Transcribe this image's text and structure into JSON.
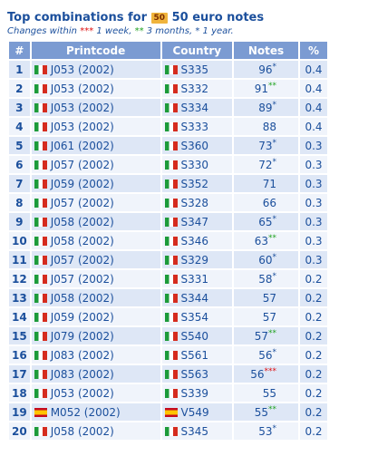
{
  "header": {
    "title_prefix": "Top combinations for",
    "badge": "50",
    "title_suffix": "50 euro notes"
  },
  "legend": {
    "prefix": "Changes within",
    "week_marker": "***",
    "week_text": "1 week,",
    "months_marker": "**",
    "months_text": "3 months,",
    "year_marker": "*",
    "year_text": "1 year."
  },
  "table": {
    "columns": [
      "#",
      "Printcode",
      "Country",
      "Notes",
      "%"
    ],
    "rows": [
      {
        "rank": "1",
        "flag": "italy-flag-icon",
        "printcode": "J053 (2002)",
        "cflag": "italy-flag-icon",
        "country": "S335",
        "notes": "96",
        "mark": "*",
        "pct": "0.4"
      },
      {
        "rank": "2",
        "flag": "italy-flag-icon",
        "printcode": "J053 (2002)",
        "cflag": "italy-flag-icon",
        "country": "S332",
        "notes": "91",
        "mark": "**",
        "pct": "0.4"
      },
      {
        "rank": "3",
        "flag": "italy-flag-icon",
        "printcode": "J053 (2002)",
        "cflag": "italy-flag-icon",
        "country": "S334",
        "notes": "89",
        "mark": "*",
        "pct": "0.4"
      },
      {
        "rank": "4",
        "flag": "italy-flag-icon",
        "printcode": "J053 (2002)",
        "cflag": "italy-flag-icon",
        "country": "S333",
        "notes": "88",
        "mark": "",
        "pct": "0.4"
      },
      {
        "rank": "5",
        "flag": "italy-flag-icon",
        "printcode": "J061 (2002)",
        "cflag": "italy-flag-icon",
        "country": "S360",
        "notes": "73",
        "mark": "*",
        "pct": "0.3"
      },
      {
        "rank": "6",
        "flag": "italy-flag-icon",
        "printcode": "J057 (2002)",
        "cflag": "italy-flag-icon",
        "country": "S330",
        "notes": "72",
        "mark": "*",
        "pct": "0.3"
      },
      {
        "rank": "7",
        "flag": "italy-flag-icon",
        "printcode": "J059 (2002)",
        "cflag": "italy-flag-icon",
        "country": "S352",
        "notes": "71",
        "mark": "",
        "pct": "0.3"
      },
      {
        "rank": "8",
        "flag": "italy-flag-icon",
        "printcode": "J057 (2002)",
        "cflag": "italy-flag-icon",
        "country": "S328",
        "notes": "66",
        "mark": "",
        "pct": "0.3"
      },
      {
        "rank": "9",
        "flag": "italy-flag-icon",
        "printcode": "J058 (2002)",
        "cflag": "italy-flag-icon",
        "country": "S347",
        "notes": "65",
        "mark": "*",
        "pct": "0.3"
      },
      {
        "rank": "10",
        "flag": "italy-flag-icon",
        "printcode": "J058 (2002)",
        "cflag": "italy-flag-icon",
        "country": "S346",
        "notes": "63",
        "mark": "**",
        "pct": "0.3"
      },
      {
        "rank": "11",
        "flag": "italy-flag-icon",
        "printcode": "J057 (2002)",
        "cflag": "italy-flag-icon",
        "country": "S329",
        "notes": "60",
        "mark": "*",
        "pct": "0.3"
      },
      {
        "rank": "12",
        "flag": "italy-flag-icon",
        "printcode": "J057 (2002)",
        "cflag": "italy-flag-icon",
        "country": "S331",
        "notes": "58",
        "mark": "*",
        "pct": "0.2"
      },
      {
        "rank": "13",
        "flag": "italy-flag-icon",
        "printcode": "J058 (2002)",
        "cflag": "italy-flag-icon",
        "country": "S344",
        "notes": "57",
        "mark": "",
        "pct": "0.2"
      },
      {
        "rank": "14",
        "flag": "italy-flag-icon",
        "printcode": "J059 (2002)",
        "cflag": "italy-flag-icon",
        "country": "S354",
        "notes": "57",
        "mark": "",
        "pct": "0.2"
      },
      {
        "rank": "15",
        "flag": "italy-flag-icon",
        "printcode": "J079 (2002)",
        "cflag": "italy-flag-icon",
        "country": "S540",
        "notes": "57",
        "mark": "**",
        "pct": "0.2"
      },
      {
        "rank": "16",
        "flag": "italy-flag-icon",
        "printcode": "J083 (2002)",
        "cflag": "italy-flag-icon",
        "country": "S561",
        "notes": "56",
        "mark": "*",
        "pct": "0.2"
      },
      {
        "rank": "17",
        "flag": "italy-flag-icon",
        "printcode": "J083 (2002)",
        "cflag": "italy-flag-icon",
        "country": "S563",
        "notes": "56",
        "mark": "***",
        "pct": "0.2"
      },
      {
        "rank": "18",
        "flag": "italy-flag-icon",
        "printcode": "J053 (2002)",
        "cflag": "italy-flag-icon",
        "country": "S339",
        "notes": "55",
        "mark": "",
        "pct": "0.2"
      },
      {
        "rank": "19",
        "flag": "spain-flag-icon",
        "printcode": "M052 (2002)",
        "cflag": "spain-flag-icon",
        "country": "V549",
        "notes": "55",
        "mark": "**",
        "pct": "0.2"
      },
      {
        "rank": "20",
        "flag": "italy-flag-icon",
        "printcode": "J058 (2002)",
        "cflag": "italy-flag-icon",
        "country": "S345",
        "notes": "53",
        "mark": "*",
        "pct": "0.2"
      }
    ]
  },
  "colors": {
    "header_bg": "#7b9bd2",
    "row_odd": "#dee7f6",
    "row_even": "#f0f4fb",
    "text": "#1b4f9c",
    "week_mark": "#e01010",
    "months_mark": "#21a321",
    "year_mark": "#1b4f9c"
  }
}
